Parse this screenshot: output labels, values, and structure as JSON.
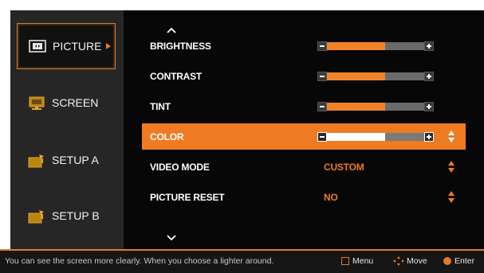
{
  "sidebar": {
    "items": [
      {
        "label": "PICTURE",
        "icon": "picture-icon",
        "active": true
      },
      {
        "label": "SCREEN",
        "icon": "screen-icon",
        "active": false
      },
      {
        "label": "SETUP A",
        "icon": "setup-icon",
        "active": false
      },
      {
        "label": "SETUP B",
        "icon": "setup-icon",
        "active": false
      }
    ]
  },
  "menu": {
    "rows": [
      {
        "label": "BRIGHTNESS",
        "level": 0.6
      },
      {
        "label": "CONTRAST",
        "level": 0.6
      },
      {
        "label": "TINT",
        "level": 0.6
      },
      {
        "label": "COLOR",
        "level": 0.6,
        "selected": true
      },
      {
        "label": "VIDEO MODE",
        "value": "CUSTOM"
      },
      {
        "label": "PICTURE RESET",
        "value": "NO"
      }
    ]
  },
  "footer": {
    "hint": "You can see the screen more clearly.  When you choose a lighter around.",
    "menu_label": "Menu",
    "move_label": "Move",
    "enter_label": "Enter"
  },
  "colors": {
    "accent": "#ee7b22",
    "background": "#070707",
    "sidebar": "#262626"
  }
}
